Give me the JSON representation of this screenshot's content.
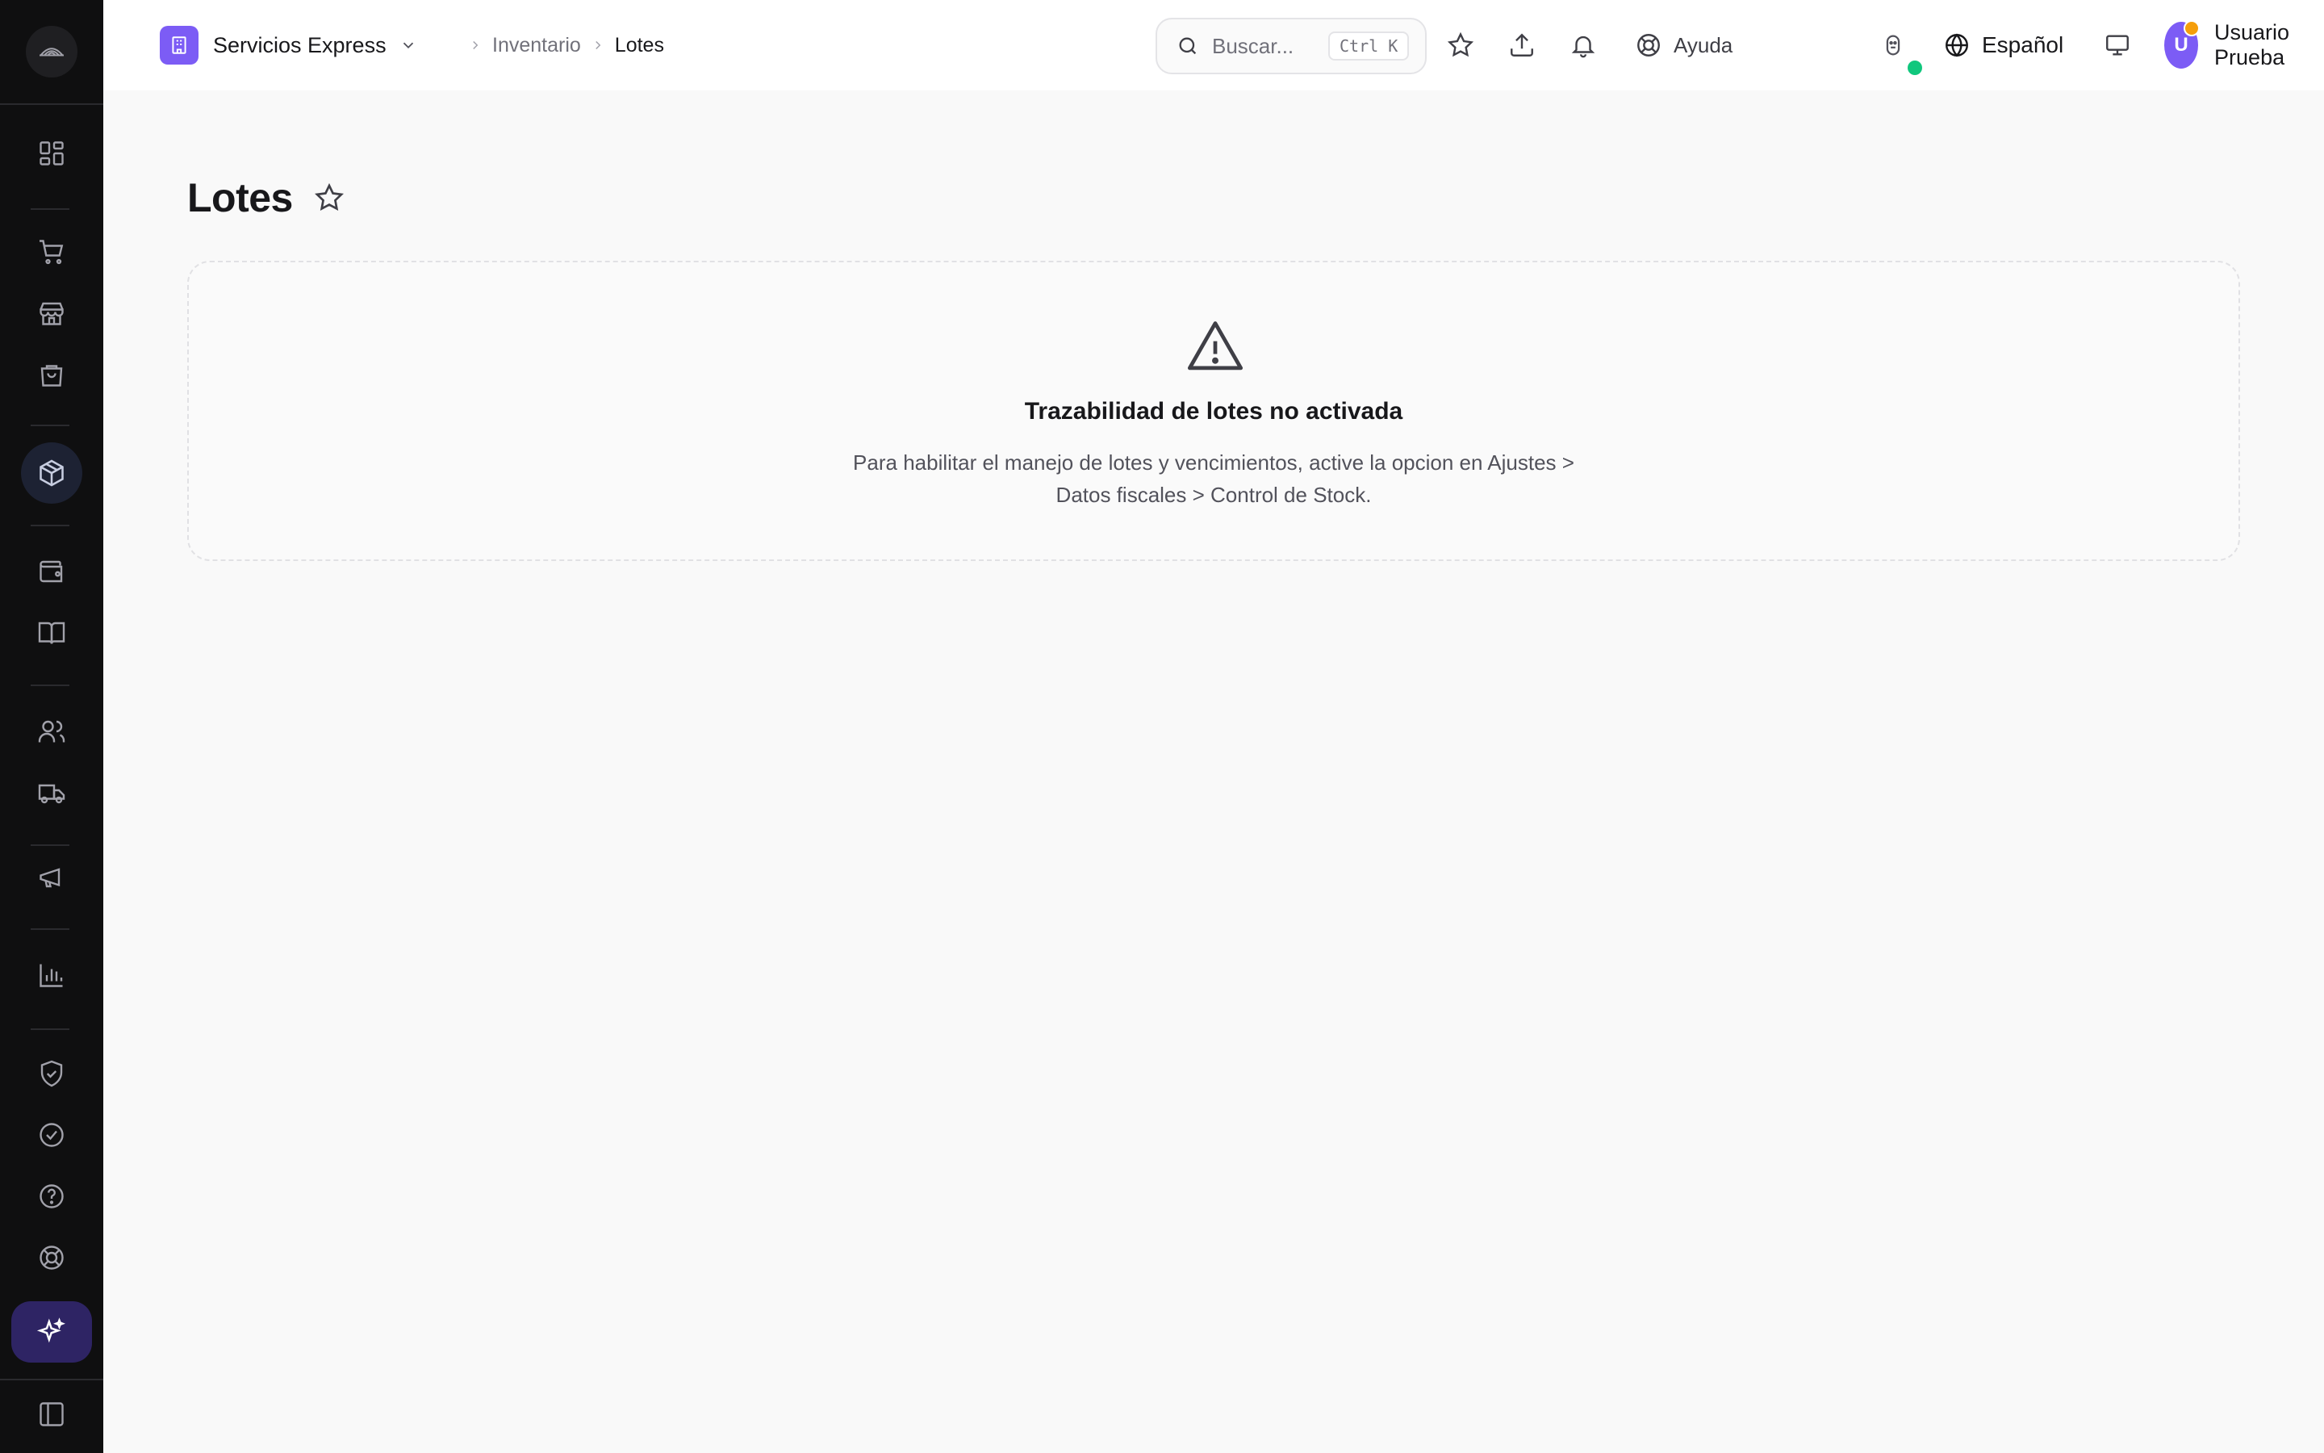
{
  "organization": {
    "name": "Servicios Express",
    "badge_icon": "building-icon",
    "brand_color": "#7c5cf5"
  },
  "breadcrumb": {
    "parent": "Inventario",
    "current": "Lotes"
  },
  "search": {
    "placeholder": "Buscar...",
    "shortcut": "Ctrl K"
  },
  "header": {
    "help_label": "Ayuda",
    "language_label": "Español",
    "user": {
      "initial": "U",
      "name": "Usuario Prueba"
    }
  },
  "page": {
    "title": "Lotes"
  },
  "notice": {
    "icon": "warning-triangle-icon",
    "title": "Trazabilidad de lotes no activada",
    "description": "Para habilitar el manejo de lotes y vencimientos, active la opcion en Ajustes > Datos fiscales > Control de Stock."
  },
  "sidebar": {
    "items": [
      "dashboard-icon",
      "cart-icon",
      "store-icon",
      "shopping-bag-icon",
      "package-icon",
      "wallet-icon",
      "book-icon",
      "users-icon",
      "truck-icon",
      "megaphone-icon",
      "bar-chart-icon",
      "shield-check-icon",
      "check-circle-icon",
      "help-circle-icon",
      "lifebuoy-icon",
      "ai-sparkles-icon",
      "sidebar-toggle-icon"
    ],
    "active": "package-icon"
  },
  "colors": {
    "sidebar_bg": "#0f0f10",
    "accent": "#7c5cf5",
    "online_status": "#10c77d",
    "notification_dot": "#f59e0b"
  }
}
